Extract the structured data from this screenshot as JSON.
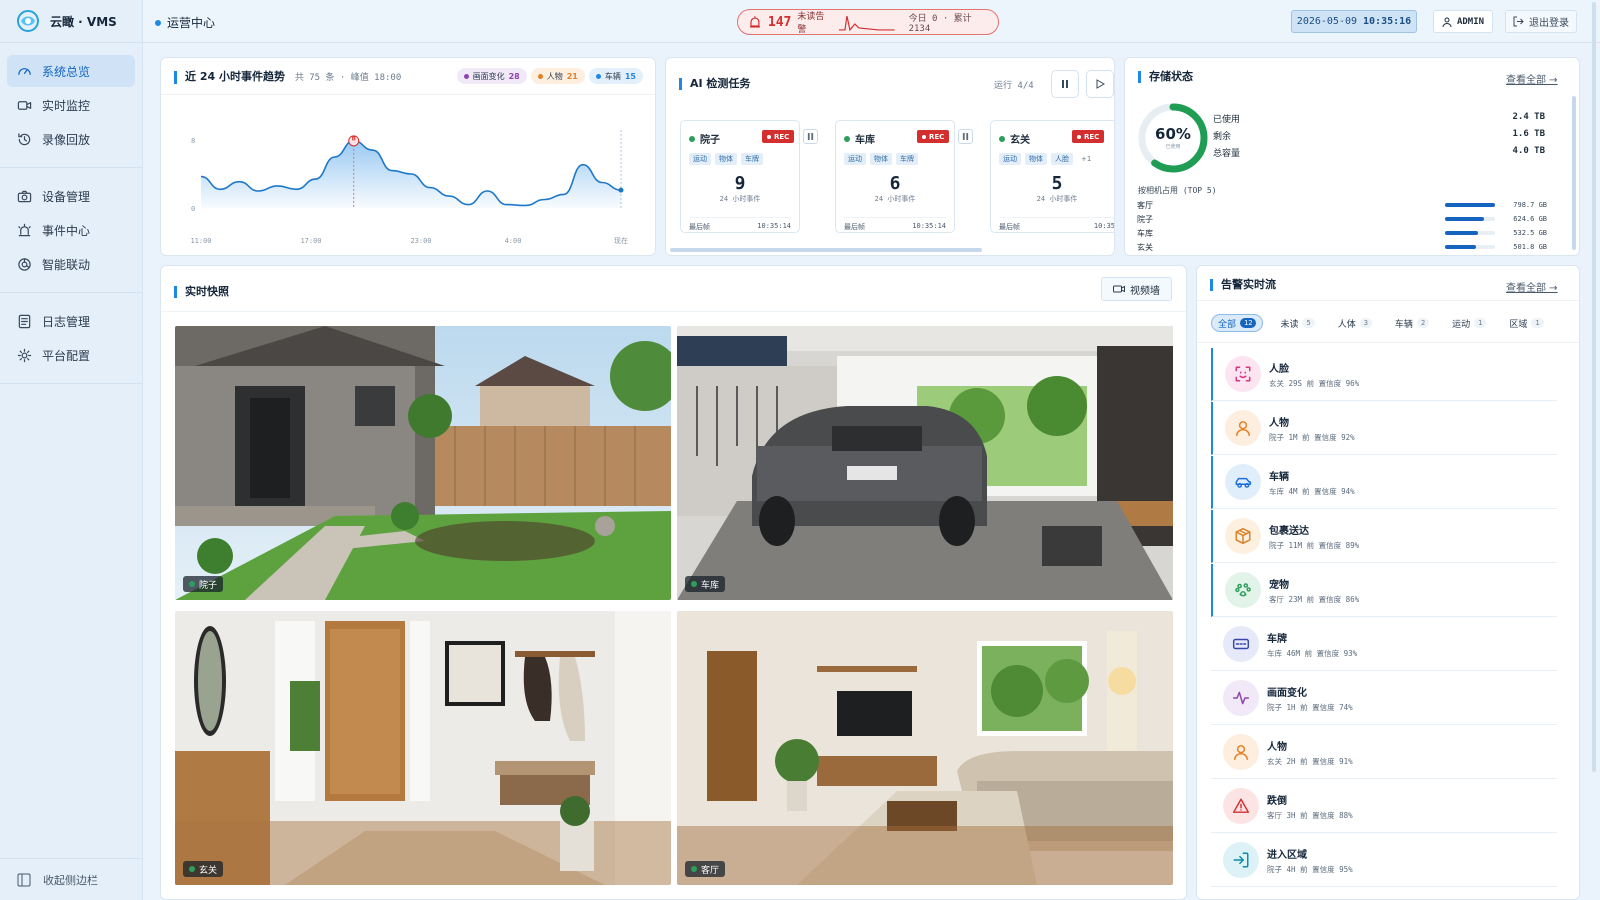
{
  "app": {
    "brand": "云瞰 · VMS",
    "breadcrumb": "运营中心"
  },
  "sidebar": {
    "groups": [
      [
        {
          "label": "系统总览",
          "icon": "gauge-icon",
          "active": true
        },
        {
          "label": "实时监控",
          "icon": "camera-icon"
        },
        {
          "label": "录像回放",
          "icon": "history-icon"
        }
      ],
      [
        {
          "label": "设备管理",
          "icon": "device-camera-icon"
        },
        {
          "label": "事件中心",
          "icon": "siren-icon"
        },
        {
          "label": "智能联动",
          "icon": "link-icon"
        }
      ],
      [
        {
          "label": "日志管理",
          "icon": "log-icon"
        },
        {
          "label": "平台配置",
          "icon": "settings-icon"
        }
      ]
    ],
    "collapse_label": "收起侧边栏"
  },
  "topbar": {
    "alarm_count": "147",
    "alarm_label": "未读告警",
    "alarm_stats": "今日 0 · 累计 2134",
    "date": "2026-05-09",
    "time": "10:35:16",
    "user": "ADMIN",
    "logout": "退出登录"
  },
  "trend": {
    "title": "近 24 小时事件趋势",
    "summary": "共 75 条 · 峰值 18:00",
    "legend": [
      {
        "label": "画面变化",
        "count": "28",
        "color": "#8e44ad",
        "bg": "#f1e8f8"
      },
      {
        "label": "人物",
        "count": "21",
        "color": "#e67e22",
        "bg": "#fdefe0"
      },
      {
        "label": "车辆",
        "count": "15",
        "color": "#1e88e5",
        "bg": "#e3effb"
      }
    ],
    "peak_label": "8",
    "chart_data": {
      "type": "area",
      "x_ticks": [
        "11:00",
        "17:00",
        "23:00",
        "4:00",
        "现在"
      ],
      "y_ticks": [
        "8",
        "0"
      ],
      "ylim": [
        0,
        8
      ],
      "values": [
        3.7,
        2.2,
        3.1,
        2.0,
        2.6,
        2.2,
        3.4,
        6.0,
        7.9,
        6.8,
        4.4,
        4.0,
        2.4,
        1.4,
        0.4,
        2.0,
        0.4,
        0.3,
        1.0,
        1.6,
        5.1,
        3.0,
        2.1
      ]
    }
  },
  "ai": {
    "title": "AI 检测任务",
    "running": "运行 4/4",
    "tasks": [
      {
        "name": "院子",
        "rec": "REC",
        "tags": [
          "运动",
          "物体",
          "车牌"
        ],
        "count": "9",
        "sub": "24 小时事件",
        "last_label": "最后帧",
        "last_time": "10:35:14"
      },
      {
        "name": "车库",
        "rec": "REC",
        "tags": [
          "运动",
          "物体",
          "车牌"
        ],
        "count": "6",
        "sub": "24 小时事件",
        "last_label": "最后帧",
        "last_time": "10:35:14"
      },
      {
        "name": "玄关",
        "rec": "REC",
        "tags": [
          "运动",
          "物体",
          "人脸"
        ],
        "more": "+1",
        "count": "5",
        "sub": "24 小时事件",
        "last_label": "最后帧",
        "last_time": "10:35"
      }
    ]
  },
  "storage": {
    "title": "存储状态",
    "view_all": "查看全部 →",
    "percent": "60%",
    "percent_value": 0.6,
    "used_caption": "已使用",
    "rows": [
      {
        "label": "已使用",
        "value": "2.4 TB"
      },
      {
        "label": "剩余",
        "value": "1.6 TB"
      },
      {
        "label": "总容量",
        "value": "4.0 TB"
      }
    ],
    "cams_title": "按相机占用 (TOP 5)",
    "cams": [
      {
        "name": "客厅",
        "value": "798.7 GB",
        "fill": 0.99
      },
      {
        "name": "院子",
        "value": "624.6 GB",
        "fill": 0.78
      },
      {
        "name": "车库",
        "value": "532.5 GB",
        "fill": 0.66
      },
      {
        "name": "玄关",
        "value": "501.8 GB",
        "fill": 0.62
      }
    ]
  },
  "snapshots": {
    "title": "实时快照",
    "wall_btn": "视频墙",
    "items": [
      {
        "label": "院子"
      },
      {
        "label": "车库"
      },
      {
        "label": "玄关"
      },
      {
        "label": "客厅"
      }
    ]
  },
  "alerts": {
    "title": "告警实时流",
    "view_all": "查看全部 →",
    "filters": [
      {
        "label": "全部",
        "count": "12",
        "active": true
      },
      {
        "label": "未读",
        "count": "5"
      },
      {
        "label": "人体",
        "count": "3"
      },
      {
        "label": "车辆",
        "count": "2"
      },
      {
        "label": "运动",
        "count": "1"
      },
      {
        "label": "区域",
        "count": "1"
      }
    ],
    "items": [
      {
        "title": "人脸",
        "meta": "玄关  29S 前  置信度 96%",
        "icon": "face-scan-icon",
        "color": "#d63384",
        "bg": "#fce4f0",
        "unread": true
      },
      {
        "title": "人物",
        "meta": "院子  1M 前  置信度 92%",
        "icon": "person-icon",
        "color": "#e67e22",
        "bg": "#fdeedf",
        "unread": true
      },
      {
        "title": "车辆",
        "meta": "车库  4M 前  置信度 94%",
        "icon": "car-icon",
        "color": "#1e6fd9",
        "bg": "#e0edfb",
        "unread": true
      },
      {
        "title": "包裹送达",
        "meta": "院子  11M 前  置信度 89%",
        "icon": "package-icon",
        "color": "#d9822b",
        "bg": "#fdf0de",
        "unread": true
      },
      {
        "title": "宠物",
        "meta": "客厅  23M 前  置信度 86%",
        "icon": "paw-icon",
        "color": "#2e9e5b",
        "bg": "#e2f4e9",
        "unread": true
      },
      {
        "title": "车牌",
        "meta": "车库  46M 前  置信度 93%",
        "icon": "plate-icon",
        "color": "#3949ab",
        "bg": "#e6e9f8",
        "unread": false
      },
      {
        "title": "画面变化",
        "meta": "院子  1H 前  置信度 74%",
        "icon": "activity-icon",
        "color": "#8e44ad",
        "bg": "#f1e8f8",
        "unread": false
      },
      {
        "title": "人物",
        "meta": "玄关  2H 前  置信度 91%",
        "icon": "person-icon",
        "color": "#e67e22",
        "bg": "#fdeedf",
        "unread": false
      },
      {
        "title": "跌倒",
        "meta": "客厅  3H 前  置信度 88%",
        "icon": "warning-icon",
        "color": "#d32f2f",
        "bg": "#fde4e4",
        "unread": false
      },
      {
        "title": "进入区域",
        "meta": "院子  4H 前  置信度 95%",
        "icon": "enter-icon",
        "color": "#0d8aa8",
        "bg": "#ddf2f7",
        "unread": false
      }
    ]
  }
}
